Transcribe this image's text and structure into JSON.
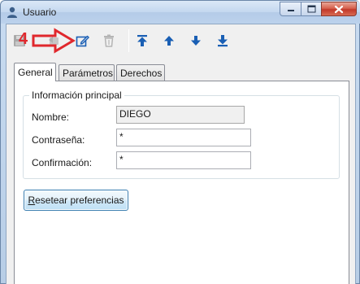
{
  "window": {
    "title": "Usuario",
    "controls": {
      "minimize": "minimize",
      "maximize": "maximize",
      "close": "close"
    }
  },
  "toolbar": {
    "annotation_number": "4",
    "buttons": [
      {
        "name": "save",
        "icon": "save-icon",
        "enabled": false
      },
      {
        "name": "cancel",
        "icon": "undo-icon",
        "enabled": false
      },
      {
        "name": "edit",
        "icon": "edit-icon",
        "enabled": true
      },
      {
        "name": "delete",
        "icon": "trash-icon",
        "enabled": false
      },
      {
        "name": "first",
        "icon": "first-record-icon",
        "enabled": true
      },
      {
        "name": "previous",
        "icon": "previous-record-icon",
        "enabled": true
      },
      {
        "name": "next",
        "icon": "next-record-icon",
        "enabled": true
      },
      {
        "name": "last",
        "icon": "last-record-icon",
        "enabled": true
      }
    ]
  },
  "tabs": [
    {
      "label": "General",
      "active": true
    },
    {
      "label": "Parámetros",
      "active": false
    },
    {
      "label": "Derechos",
      "active": false
    }
  ],
  "general": {
    "group_title": "Información principal",
    "fields": {
      "nombre": {
        "label": "Nombre:",
        "value": "DIEGO"
      },
      "contrasena": {
        "label": "Contraseña:",
        "value": "*"
      },
      "confirmacion": {
        "label": "Confirmación:",
        "value": "*"
      }
    },
    "reset_button_rest": "esetear preferencias",
    "reset_button_mnemonic": "R"
  },
  "colors": {
    "accent": "#1a5fb4",
    "annotation": "#e0282d"
  }
}
